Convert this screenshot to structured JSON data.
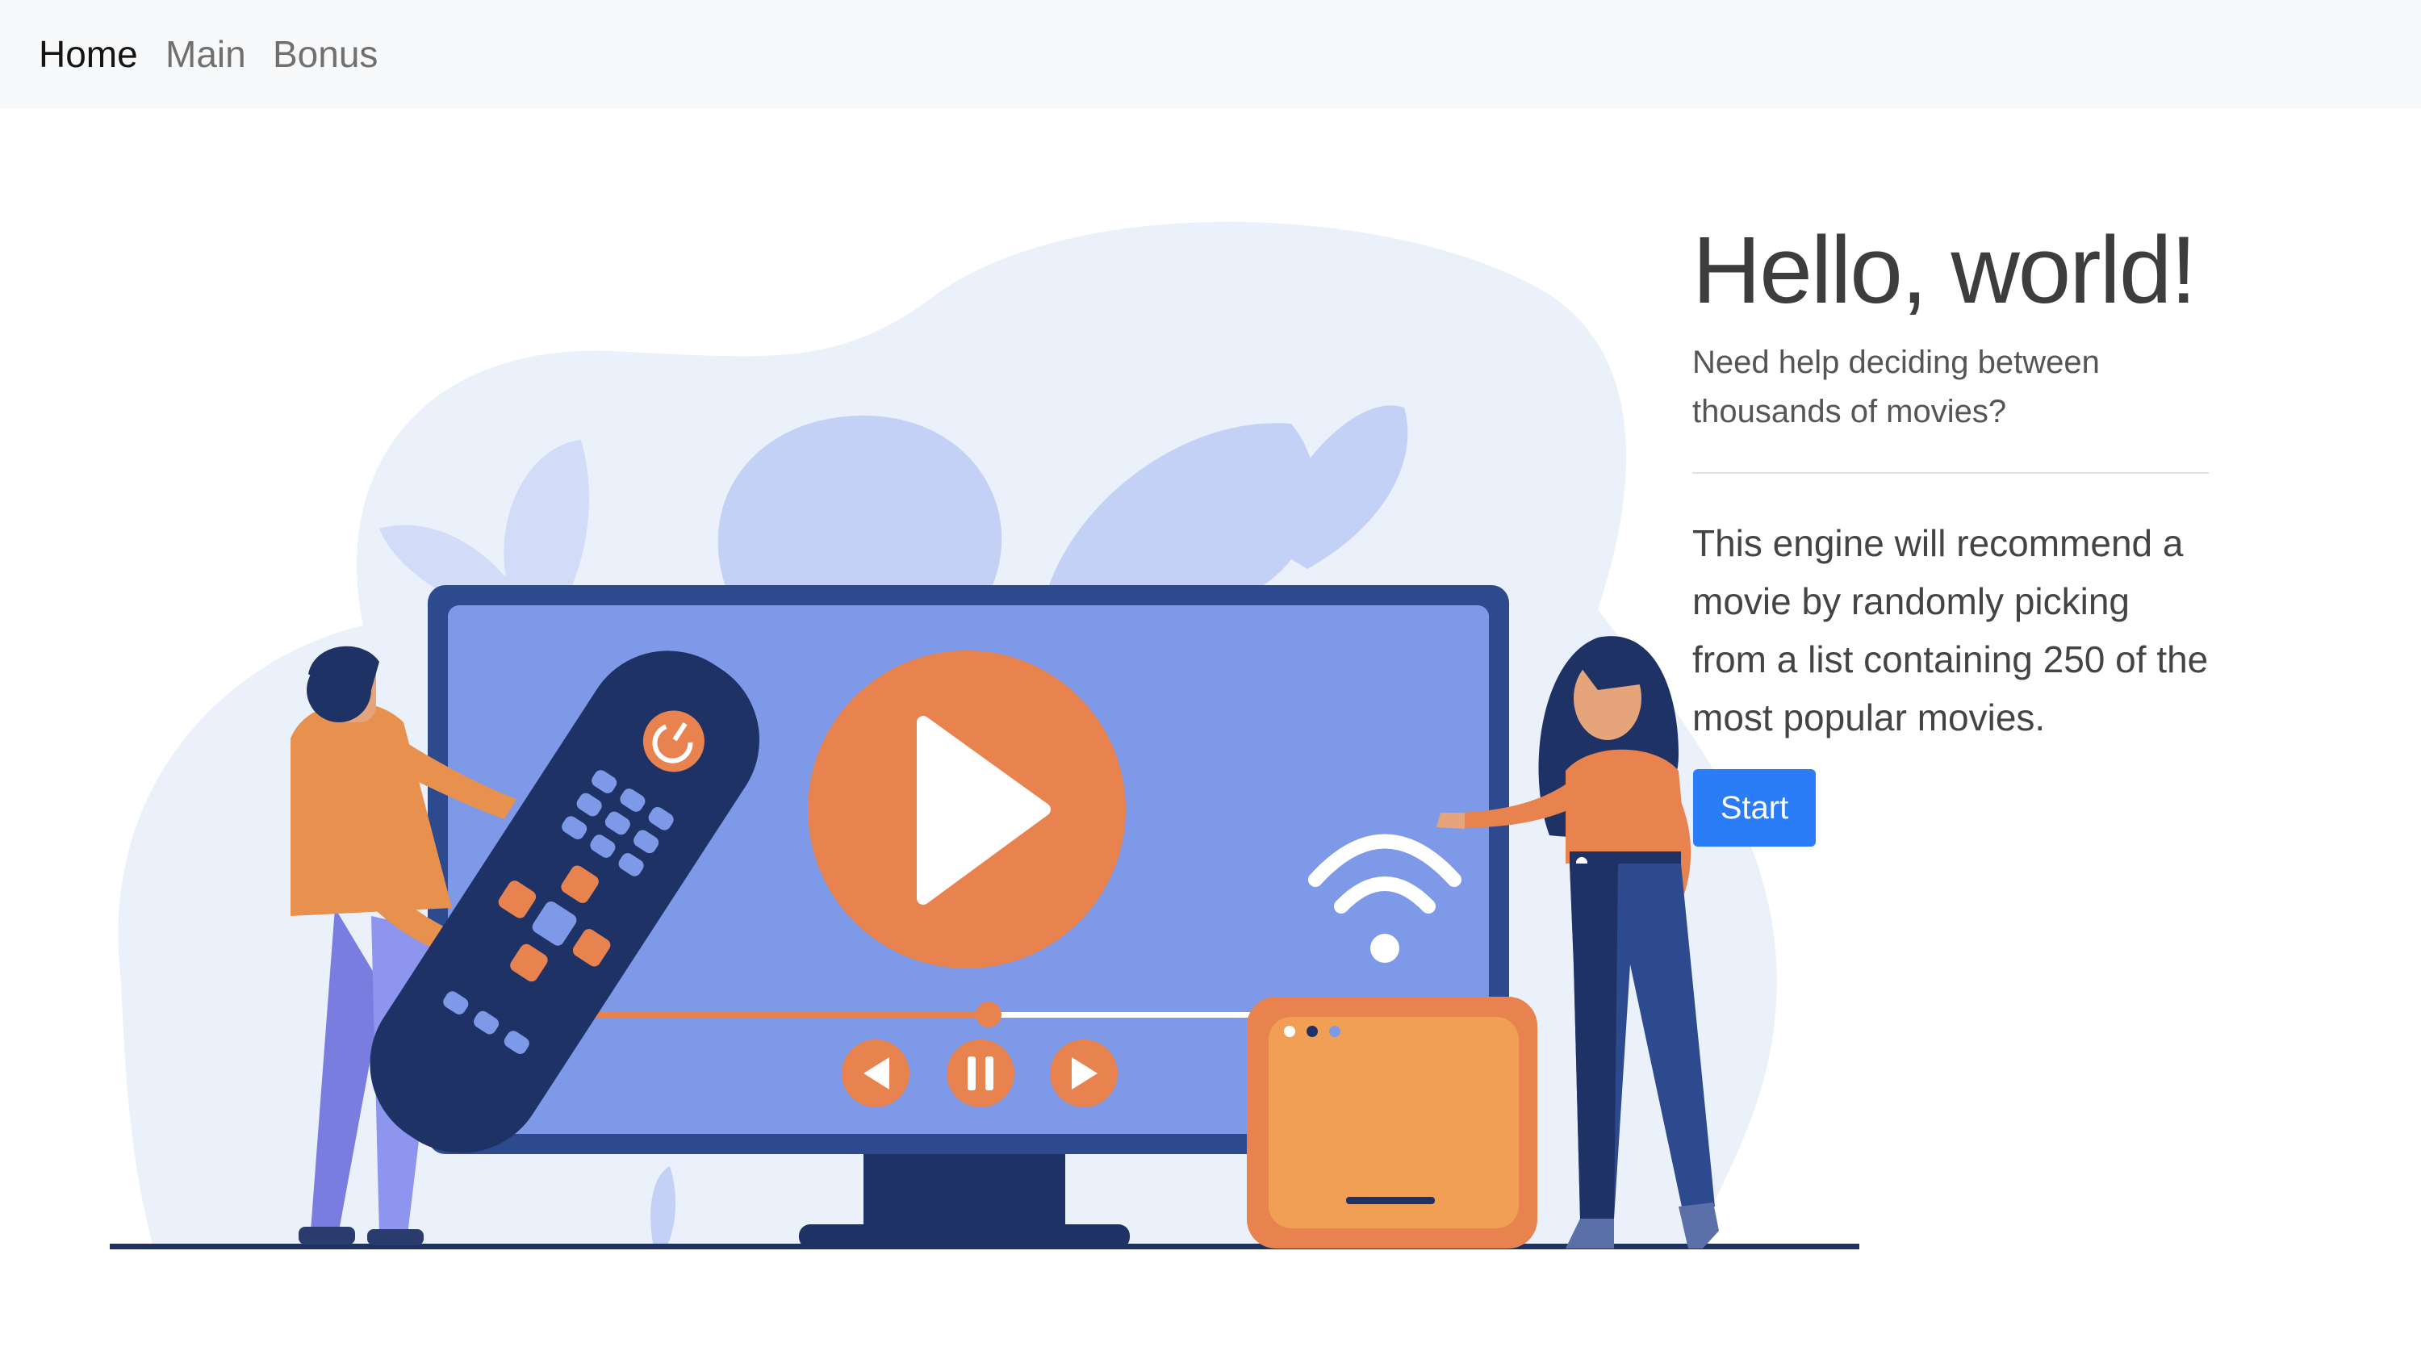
{
  "nav": {
    "items": [
      {
        "label": "Home",
        "active": true
      },
      {
        "label": "Main",
        "active": false
      },
      {
        "label": "Bonus",
        "active": false
      }
    ]
  },
  "hero": {
    "title": "Hello, world!",
    "lead": "Need help deciding between thousands of movies?",
    "description": "This engine will recommend a movie by randomly picking from a list containing 250 of the most popular movies.",
    "button_label": "Start"
  },
  "colors": {
    "navbar_bg": "#f8f9fa",
    "button_primary": "#2a7df6",
    "illustration_orange": "#e8834f",
    "illustration_navy": "#1f3266",
    "illustration_blue": "#7d99e8"
  },
  "illustration": {
    "subject": "people-with-tv-remote-and-streaming-screen",
    "icons": [
      "play-icon",
      "pause-icon",
      "rewind-icon",
      "forward-icon",
      "wifi-icon",
      "power-icon"
    ]
  }
}
